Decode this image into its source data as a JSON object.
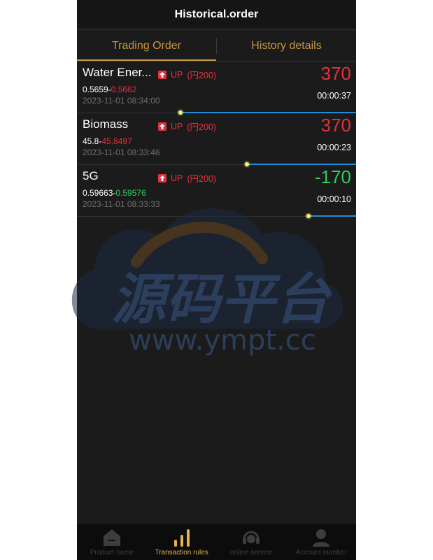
{
  "header": {
    "title": "Historical.order"
  },
  "tabs": [
    {
      "label": "Trading Order"
    },
    {
      "label": "History details"
    }
  ],
  "orders": [
    {
      "name": "Water Ener...",
      "direction": "UP",
      "amount": "(円200)",
      "price_open": "0.5659-",
      "price_close": "0.5662",
      "time": "2023-11-01 08:34:00",
      "pnl": "370",
      "countdown": "00:00:37",
      "progress": 0.63
    },
    {
      "name": "Biomass",
      "direction": "UP",
      "amount": "(円200)",
      "price_open": "45.8-",
      "price_close": "45.8497",
      "time": "2023-11-01 08:33:46",
      "pnl": "370",
      "countdown": "00:00:23",
      "progress": 0.39
    },
    {
      "name": "5G",
      "direction": "UP",
      "amount": "(円200)",
      "price_open": "0.59663-",
      "price_close": "0.59576",
      "time": "2023-11-01 08:33:33",
      "pnl": "-170",
      "countdown": "00:00:10",
      "progress": 0.17
    }
  ],
  "watermark": {
    "title": "源码平台",
    "url": "www.ympt.cc"
  },
  "nav": [
    {
      "label": "Product name",
      "icon": "home-icon"
    },
    {
      "label": "Transaction rules",
      "icon": "bar-chart-icon"
    },
    {
      "label": "online service",
      "icon": "headset-icon"
    },
    {
      "label": "Account number",
      "icon": "user-icon"
    }
  ],
  "colors": {
    "accent": "#c9973f",
    "up": "#e8303c",
    "down": "#2fcf57",
    "progress": "#1e8fd6"
  }
}
